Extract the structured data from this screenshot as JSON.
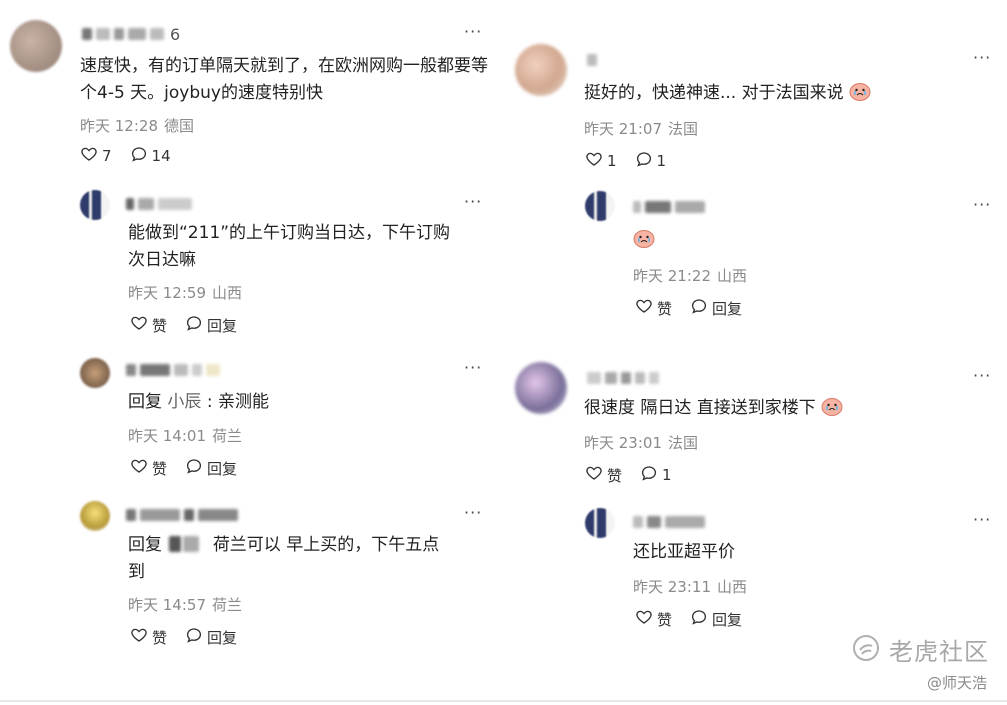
{
  "left": {
    "top": {
      "name_tail": "6",
      "text": "速度快，有的订单隔天就到了，在欧洲网购一般都要等个4-5 天。joybuy的速度特别快",
      "time": "昨天 12:28",
      "location": "德国",
      "likes": "7",
      "comments": "14"
    },
    "replies": [
      {
        "text_line1": "能做到“211”的上午订购当日达，下午订购",
        "text_line2": "次日达嘛",
        "time": "昨天 12:59",
        "location": "山西",
        "like_label": "赞",
        "reply_label": "回复"
      },
      {
        "reply_word": "回复",
        "reply_target": "小辰",
        "text": ": 亲测能",
        "time": "昨天 14:01",
        "location": "荷兰",
        "like_label": "赞",
        "reply_label": "回复"
      },
      {
        "reply_word": "回复",
        "text_line1": "荷兰可以 早上买的，下午五点",
        "text_line2": "到",
        "time": "昨天 14:57",
        "location": "荷兰",
        "like_label": "赞",
        "reply_label": "回复"
      }
    ]
  },
  "right": {
    "top1": {
      "text": "挺好的，快递神速... 对于法国来说",
      "time": "昨天 21:07",
      "location": "法国",
      "likes": "1",
      "comments": "1"
    },
    "reply1": {
      "time": "昨天 21:22",
      "location": "山西",
      "like_label": "赞",
      "reply_label": "回复"
    },
    "top2": {
      "text": "很速度 隔日达 直接送到家楼下",
      "time": "昨天 23:01",
      "location": "法国",
      "like_label": "赞",
      "comments": "1"
    },
    "reply2": {
      "text": "还比亚超平价",
      "time": "昨天 23:11",
      "location": "山西",
      "like_label": "赞",
      "reply_label": "回复"
    }
  },
  "more_label": "···",
  "watermark": {
    "title": "老虎社区",
    "sub": "@师天浩"
  },
  "icons": {
    "like": "heart-icon",
    "comment": "comment-bubble-icon",
    "more": "more-dots-icon",
    "emoji": "crying-peach-emoji-icon"
  }
}
